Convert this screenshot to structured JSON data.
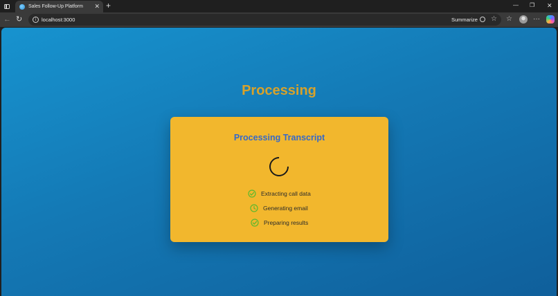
{
  "browser": {
    "tab_title": "Sales Follow-Up Platform",
    "tab_close": "✕",
    "new_tab": "+",
    "url": "localhost:3000",
    "summarize_label": "Summarize",
    "window_controls": {
      "minimize": "—",
      "maximize": "❐",
      "close": "✕"
    }
  },
  "page": {
    "heading": "Processing",
    "card": {
      "title": "Processing Transcript",
      "steps": [
        {
          "label": "Extracting call data",
          "status": "complete",
          "icon": "check-circle-icon"
        },
        {
          "label": "Generating email",
          "status": "in-progress",
          "icon": "clock-icon"
        },
        {
          "label": "Preparing results",
          "status": "complete",
          "icon": "check-circle-icon"
        }
      ]
    }
  },
  "colors": {
    "background_gradient": [
      "#1793cf",
      "#0f5f9b"
    ],
    "heading": "#d8a22a",
    "card": "#f2b72d",
    "card_title": "#3569c9",
    "step_icon": "#5cb82e"
  }
}
